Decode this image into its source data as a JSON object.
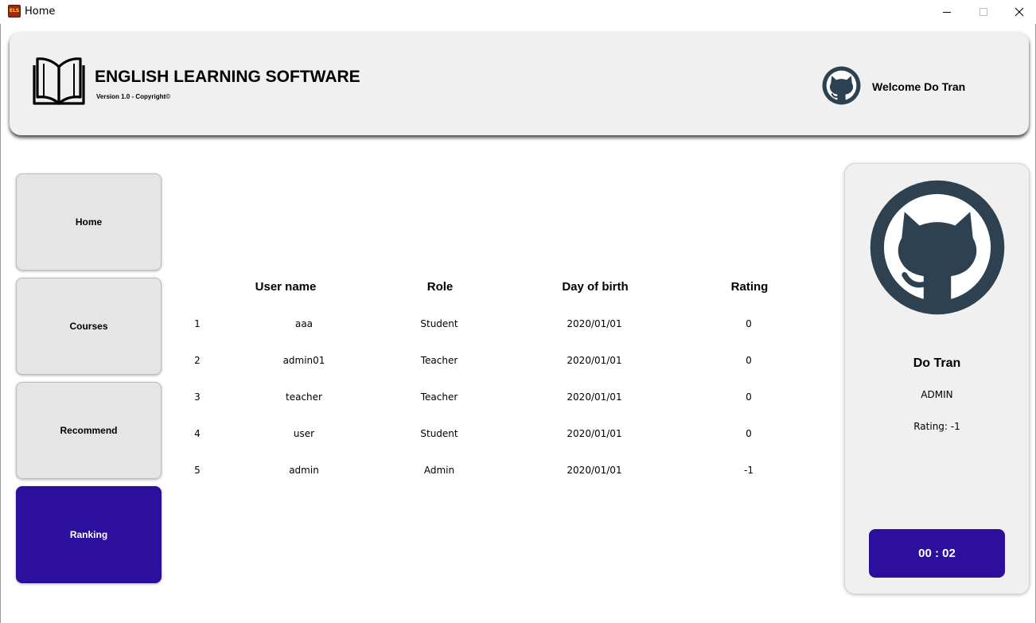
{
  "window": {
    "title": "Home",
    "icon_text": "ELS",
    "controls": [
      "minimize-icon",
      "maximize-icon",
      "close-icon"
    ]
  },
  "header": {
    "app_name": "ENGLISH LEARNING SOFTWARE",
    "version": "Version 1.0 - Copyright©",
    "logo_icon": "open-book-icon",
    "avatar_icon": "github-octocat-icon",
    "welcome": "Welcome Do Tran"
  },
  "nav": {
    "items": [
      {
        "label": "Home",
        "active": false
      },
      {
        "label": "Courses",
        "active": false
      },
      {
        "label": "Recommend",
        "active": false
      },
      {
        "label": "Ranking",
        "active": true
      }
    ],
    "active_color": "#2c0f9c",
    "inactive_color": "#e5e5e5"
  },
  "ranking": {
    "headers": [
      "User name",
      "Role",
      "Day of birth",
      "Rating"
    ],
    "rows": [
      {
        "rank": "1",
        "username": "aaa",
        "role": "Student",
        "dob": "2020/01/01",
        "rating": "0"
      },
      {
        "rank": "2",
        "username": "admin01",
        "role": "Teacher",
        "dob": "2020/01/01",
        "rating": "0"
      },
      {
        "rank": "3",
        "username": "teacher",
        "role": "Teacher",
        "dob": "2020/01/01",
        "rating": "0"
      },
      {
        "rank": "4",
        "username": "user",
        "role": "Student",
        "dob": "2020/01/01",
        "rating": "0"
      },
      {
        "rank": "5",
        "username": "admin",
        "role": "Admin",
        "dob": "2020/01/01",
        "rating": "-1"
      }
    ]
  },
  "profile": {
    "avatar_icon": "github-octocat-icon",
    "name": "Do Tran",
    "role": "ADMIN",
    "rating": "Rating: -1",
    "timer": "00 : 02"
  },
  "colors": {
    "accent": "#2c0f9c",
    "avatar": "#2d4150",
    "card_bg": "#f0f0f0"
  }
}
